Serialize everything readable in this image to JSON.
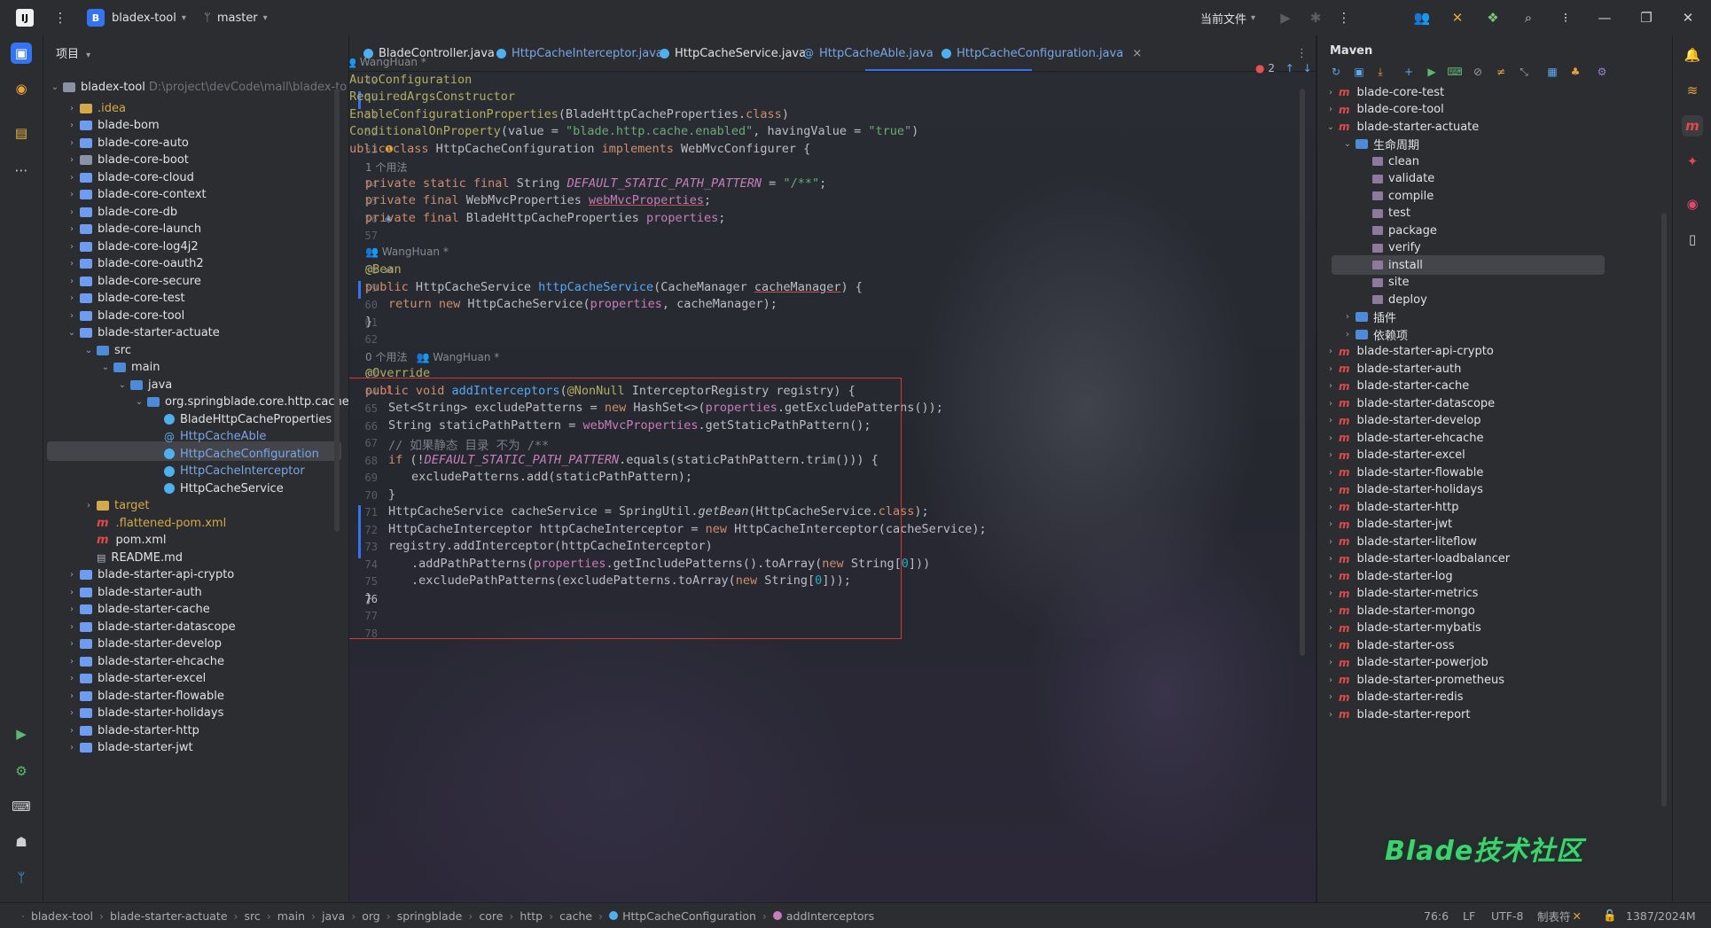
{
  "titlebar": {
    "project_badge": "B",
    "project_name": "bladex-tool",
    "branch": "master",
    "run_config": "当前文件"
  },
  "project_panel": {
    "title": "项目",
    "root": {
      "label": "bladex-tool",
      "path": "D:\\project\\devCode\\mall\\bladex-to"
    },
    "items": [
      ".idea",
      "blade-bom",
      "blade-core-auto",
      "blade-core-boot",
      "blade-core-cloud",
      "blade-core-context",
      "blade-core-db",
      "blade-core-launch",
      "blade-core-log4j2",
      "blade-core-oauth2",
      "blade-core-secure",
      "blade-core-test",
      "blade-core-tool",
      "blade-starter-actuate",
      "src",
      "main",
      "java",
      "org.springblade.core.http.cache",
      "BladeHttpCacheProperties",
      "HttpCacheAble",
      "HttpCacheConfiguration",
      "HttpCacheInterceptor",
      "HttpCacheService",
      "target",
      ".flattened-pom.xml",
      "pom.xml",
      "README.md",
      "blade-starter-api-crypto",
      "blade-starter-auth",
      "blade-starter-cache",
      "blade-starter-datascope",
      "blade-starter-develop",
      "blade-starter-ehcache",
      "blade-starter-excel",
      "blade-starter-flowable",
      "blade-starter-holidays",
      "blade-starter-http",
      "blade-starter-jwt"
    ]
  },
  "tabs": [
    {
      "label": "BladeController.java"
    },
    {
      "label": "HttpCacheInterceptor.java"
    },
    {
      "label": "HttpCacheService.java"
    },
    {
      "label": "HttpCacheAble.java"
    },
    {
      "label": "HttpCacheConfiguration.java",
      "close": "×"
    }
  ],
  "editor": {
    "problems_count": "2",
    "hints": {
      "author1": "WangHuan *",
      "usage1": "1 个用法",
      "author2": "WangHuan *",
      "usage3": "0 个用法",
      "author3": "WangHuan *"
    },
    "line_numbers": [
      "49",
      "50",
      "51",
      "52",
      "53",
      "54",
      "55",
      "56",
      "57",
      "58",
      "59",
      "60",
      "61",
      "62",
      "63",
      "64",
      "65",
      "66",
      "67",
      "68",
      "69",
      "70",
      "71",
      "72",
      "73",
      "74",
      "75",
      "76",
      "77",
      "78"
    ],
    "lines": {
      "l49": "@AutoConfiguration",
      "l50": "@RequiredArgsConstructor",
      "l51a": "@EnableConfigurationProperties",
      "l51b": "(BladeHttpCacheProperties.",
      "l51c": "class",
      "l51d": ")",
      "l52a": "@ConditionalOnProperty",
      "l52b": "(value = ",
      "l52c": "\"blade.http.cache.enabled\"",
      "l52d": ", havingValue = ",
      "l52e": "\"true\"",
      "l52f": ")",
      "l53a": "public class ",
      "l53b": "HttpCacheConfiguration ",
      "l53c": "implements ",
      "l53d": "WebMvcConfigurer {",
      "l54a": "private static final ",
      "l54b": "String ",
      "l54c": "DEFAULT_STATIC_PATH_PATTERN",
      "l54d": " = ",
      "l54e": "\"/**\"",
      "l54f": ";",
      "l55a": "private final ",
      "l55b": "WebMvcProperties ",
      "l55c": "webMvcProperties",
      "l55d": ";",
      "l56a": "private final ",
      "l56b": "BladeHttpCacheProperties ",
      "l56c": "properties",
      "l56d": ";",
      "l58": "@Bean",
      "l59a": "public ",
      "l59b": "HttpCacheService ",
      "l59c": "httpCacheService",
      "l59d": "(CacheManager ",
      "l59e": "cacheManager",
      "l59f": ") {",
      "l60a": "return new ",
      "l60b": "HttpCacheService(",
      "l60c": "properties",
      "l60d": ", cacheManager);",
      "l61": "}",
      "l63": "@Override",
      "l64a": "public void ",
      "l64b": "addInterceptors",
      "l64c": "(",
      "l64d": "@NonNull ",
      "l64e": "InterceptorRegistry registry) {",
      "l65a": "Set<String> excludePatterns = ",
      "l65b": "new ",
      "l65c": "HashSet<>(",
      "l65d": "properties",
      "l65e": ".getExcludePatterns());",
      "l66a": "String staticPathPattern = ",
      "l66b": "webMvcProperties",
      "l66c": ".getStaticPathPattern();",
      "l67": "// 如果静态 目录 不为 /**",
      "l68a": "if ",
      "l68b": "(!",
      "l68c": "DEFAULT_STATIC_PATH_PATTERN",
      "l68d": ".equals(staticPathPattern.trim())) {",
      "l69": "excludePatterns.add(staticPathPattern);",
      "l70": "}",
      "l71a": "HttpCacheService cacheService = SpringUtil.",
      "l71b": "getBean",
      "l71c": "(HttpCacheService.",
      "l71d": "class",
      "l71e": ");",
      "l72a": "HttpCacheInterceptor httpCacheInterceptor = ",
      "l72b": "new ",
      "l72c": "HttpCacheInterceptor(cacheService);",
      "l73": "registry.addInterceptor(httpCacheInterceptor)",
      "l74a": ".addPathPatterns(",
      "l74b": "properties",
      "l74c": ".getIncludePatterns().toArray(",
      "l74d": "new ",
      "l74e": "String[",
      "l74f": "0",
      "l74g": "]))",
      "l75a": ".excludePathPatterns(excludePatterns.toArray(",
      "l75b": "new ",
      "l75c": "String[",
      "l75d": "0",
      "l75e": "]));",
      "l76": "}",
      "l77": "}"
    }
  },
  "maven": {
    "title": "Maven",
    "items": [
      "blade-core-test",
      "blade-core-tool",
      "blade-starter-actuate",
      "生命周期",
      "clean",
      "validate",
      "compile",
      "test",
      "package",
      "verify",
      "install",
      "site",
      "deploy",
      "插件",
      "依赖项",
      "blade-starter-api-crypto",
      "blade-starter-auth",
      "blade-starter-cache",
      "blade-starter-datascope",
      "blade-starter-develop",
      "blade-starter-ehcache",
      "blade-starter-excel",
      "blade-starter-flowable",
      "blade-starter-holidays",
      "blade-starter-http",
      "blade-starter-jwt",
      "blade-starter-liteflow",
      "blade-starter-loadbalancer",
      "blade-starter-log",
      "blade-starter-metrics",
      "blade-starter-mongo",
      "blade-starter-mybatis",
      "blade-starter-oss",
      "blade-starter-powerjob",
      "blade-starter-prometheus",
      "blade-starter-redis",
      "blade-starter-report"
    ]
  },
  "watermark": "Blade技术社区",
  "statusbar": {
    "breadcrumbs": [
      "bladex-tool",
      "blade-starter-actuate",
      "src",
      "main",
      "java",
      "org",
      "springblade",
      "core",
      "http",
      "cache",
      "HttpCacheConfiguration",
      "addInterceptors"
    ],
    "position": "76:6",
    "line_sep": "LF",
    "encoding": "UTF-8",
    "indent": "制表符",
    "memory": "1387/2024M"
  },
  "colors": {
    "accent": "#3574f0",
    "highlight_box": "#d23a3a",
    "watermark": "#40d070"
  }
}
